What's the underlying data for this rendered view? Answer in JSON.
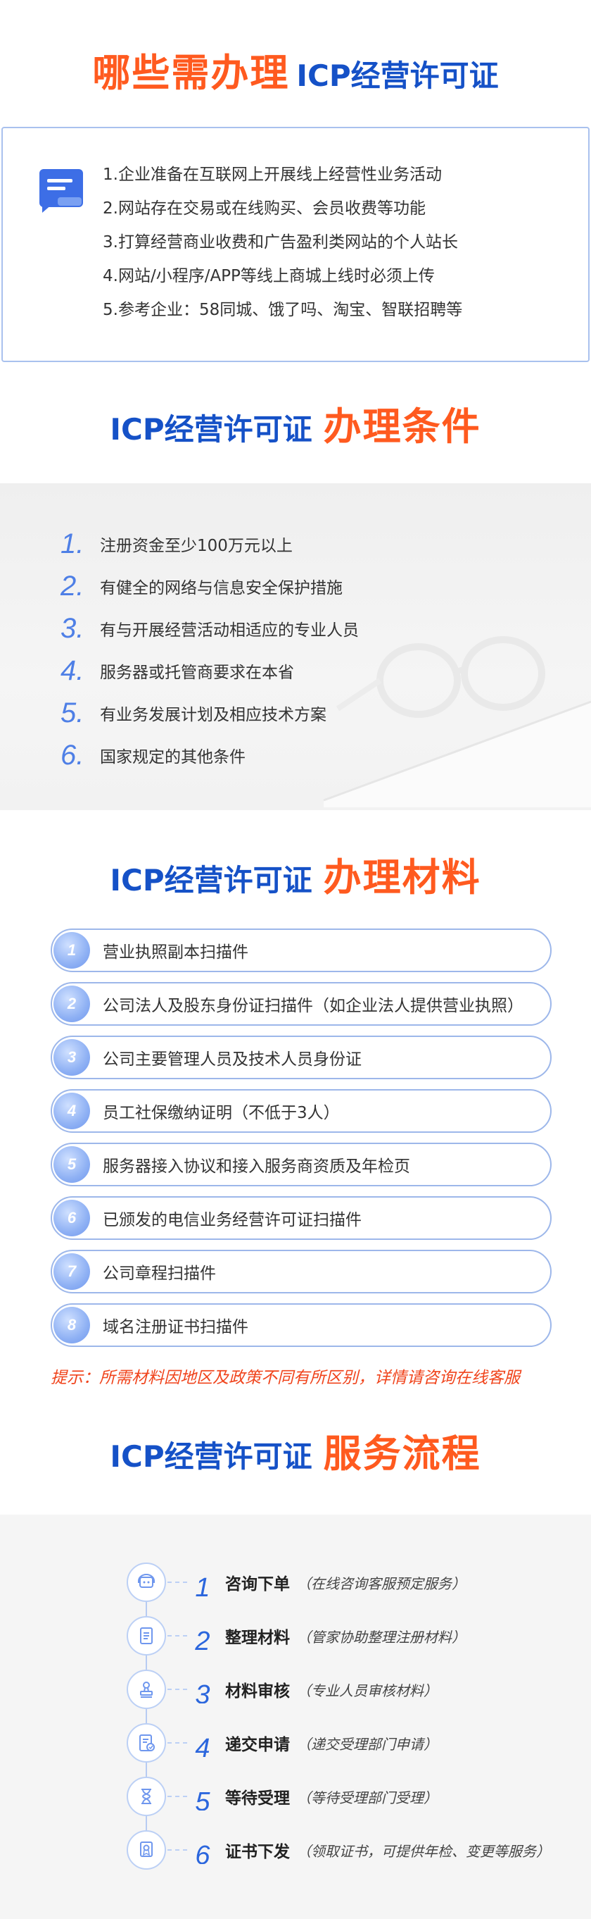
{
  "s1": {
    "title_orange": "哪些需办理",
    "title_blue": "ICP经营许可证",
    "icon": "document-chat-icon",
    "items": [
      "1.企业准备在互联网上开展线上经营性业务活动",
      "2.网站存在交易或在线购买、会员收费等功能",
      "3.打算经营商业收费和广告盈利类网站的个人站长",
      "4.网站/小程序/APP等线上商城上线时必须上传",
      "5.参考企业：58同城、饿了吗、淘宝、智联招聘等"
    ]
  },
  "s2": {
    "title_blue": "ICP经营许可证",
    "title_orange": "办理条件",
    "items": [
      {
        "num": "1.",
        "text": "注册资金至少100万元以上"
      },
      {
        "num": "2.",
        "text": "有健全的网络与信息安全保护措施"
      },
      {
        "num": "3.",
        "text": "有与开展经营活动相适应的专业人员"
      },
      {
        "num": "4.",
        "text": "服务器或托管商要求在本省"
      },
      {
        "num": "5.",
        "text": "有业务发展计划及相应技术方案"
      },
      {
        "num": "6.",
        "text": "国家规定的其他条件"
      }
    ]
  },
  "s3": {
    "title_blue": "ICP经营许可证",
    "title_orange": "办理材料",
    "items": [
      {
        "num": "1",
        "text": "营业执照副本扫描件"
      },
      {
        "num": "2",
        "text": "公司法人及股东身份证扫描件（如企业法人提供营业执照）"
      },
      {
        "num": "3",
        "text": "公司主要管理人员及技术人员身份证"
      },
      {
        "num": "4",
        "text": "员工社保缴纳证明（不低于3人）"
      },
      {
        "num": "5",
        "text": "服务器接入协议和接入服务商资质及年检页"
      },
      {
        "num": "6",
        "text": "已颁发的电信业务经营许可证扫描件"
      },
      {
        "num": "7",
        "text": "公司章程扫描件"
      },
      {
        "num": "8",
        "text": "域名注册证书扫描件"
      }
    ],
    "tip": "提示：所需材料因地区及政策不同有所区别，详情请咨询在线客服"
  },
  "s4": {
    "title_blue": "ICP经营许可证",
    "title_orange": "服务流程",
    "steps": [
      {
        "num": "1",
        "name": "咨询下单",
        "desc": "（在线咨询客服预定服务）",
        "icon": "customer-service-icon"
      },
      {
        "num": "2",
        "name": "整理材料",
        "desc": "（管家协助整理注册材料）",
        "icon": "document-list-icon"
      },
      {
        "num": "3",
        "name": "材料审核",
        "desc": "（专业人员审核材料）",
        "icon": "stamp-icon"
      },
      {
        "num": "4",
        "name": "递交申请",
        "desc": "（递交受理部门申请）",
        "icon": "form-submit-icon"
      },
      {
        "num": "5",
        "name": "等待受理",
        "desc": "（等待受理部门受理）",
        "icon": "hourglass-icon"
      },
      {
        "num": "6",
        "name": "证书下发",
        "desc": "（领取证书，可提供年检、变更等服务）",
        "icon": "certificate-icon"
      }
    ]
  }
}
